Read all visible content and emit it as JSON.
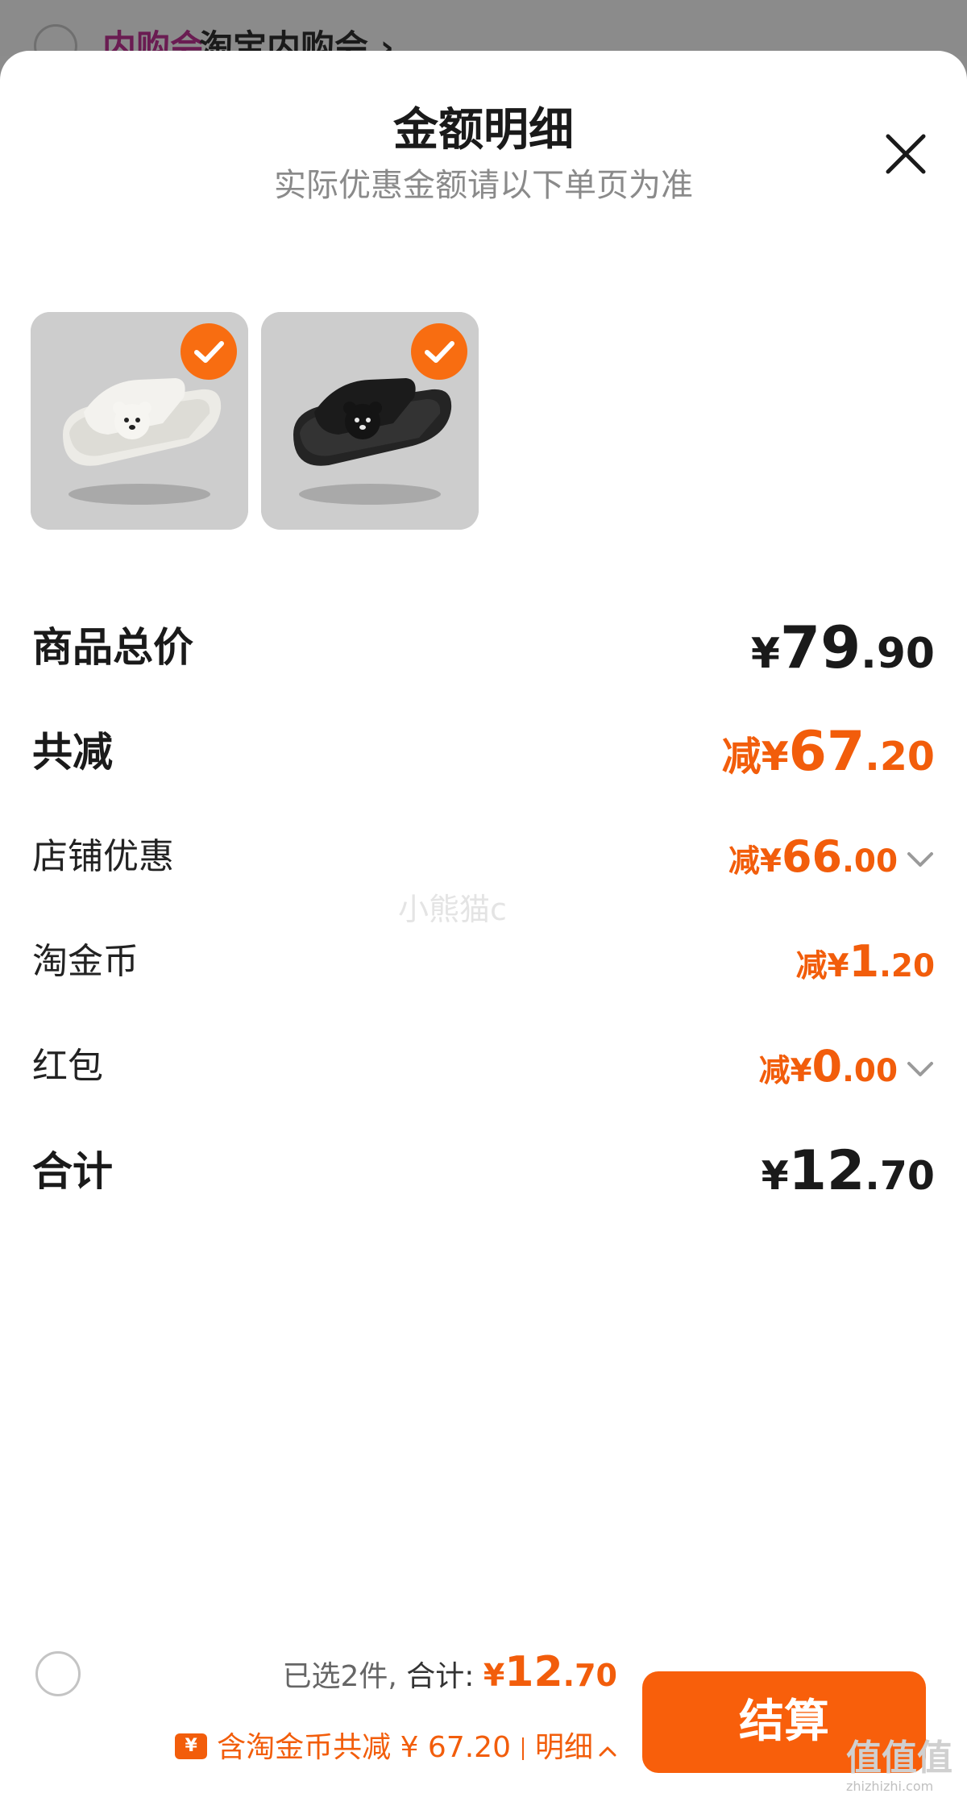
{
  "background_page": {
    "tag_label": "内购会",
    "title": "淘宝内购会 ›"
  },
  "sheet": {
    "title": "金额明细",
    "subtitle": "实际优惠金额请以下单页为准",
    "close_icon": "close-icon"
  },
  "products": [
    {
      "name": "white-bear-slide-sandal",
      "selected": true
    },
    {
      "name": "black-bear-slide-sandal",
      "selected": true
    }
  ],
  "rows": {
    "subtotal": {
      "label": "商品总价",
      "currency": "¥",
      "int": "79",
      "dec": ".90"
    },
    "total_discount": {
      "label": "共减",
      "prefix": "减",
      "currency": "¥",
      "int": "67",
      "dec": ".20"
    },
    "store_discount": {
      "label": "店铺优惠",
      "prefix": "减",
      "currency": "¥",
      "int": "66",
      "dec": ".00"
    },
    "taojinbi": {
      "label": "淘金币",
      "prefix": "减",
      "currency": "¥",
      "int": "1",
      "dec": ".20"
    },
    "red_packet": {
      "label": "红包",
      "prefix": "减",
      "currency": "¥",
      "int": "0",
      "dec": ".00"
    },
    "total": {
      "label": "合计",
      "currency": "¥",
      "int": "12",
      "dec": ".70"
    }
  },
  "watermark": "小熊猫c",
  "footer": {
    "selected": "已选2件,",
    "total_label": "合计:",
    "total_currency": "¥",
    "total_int": "12",
    "total_dec": ".70",
    "discount_text": "含淘金币共减 ¥ 67.20",
    "detail_label": "明细",
    "checkout_label": "结算"
  },
  "corner_logo": {
    "text": "值值值",
    "url": "zhizhizhi.com"
  },
  "colors": {
    "accent": "#f25d0b",
    "button": "#f85f0b",
    "text": "#1a1a1a"
  }
}
